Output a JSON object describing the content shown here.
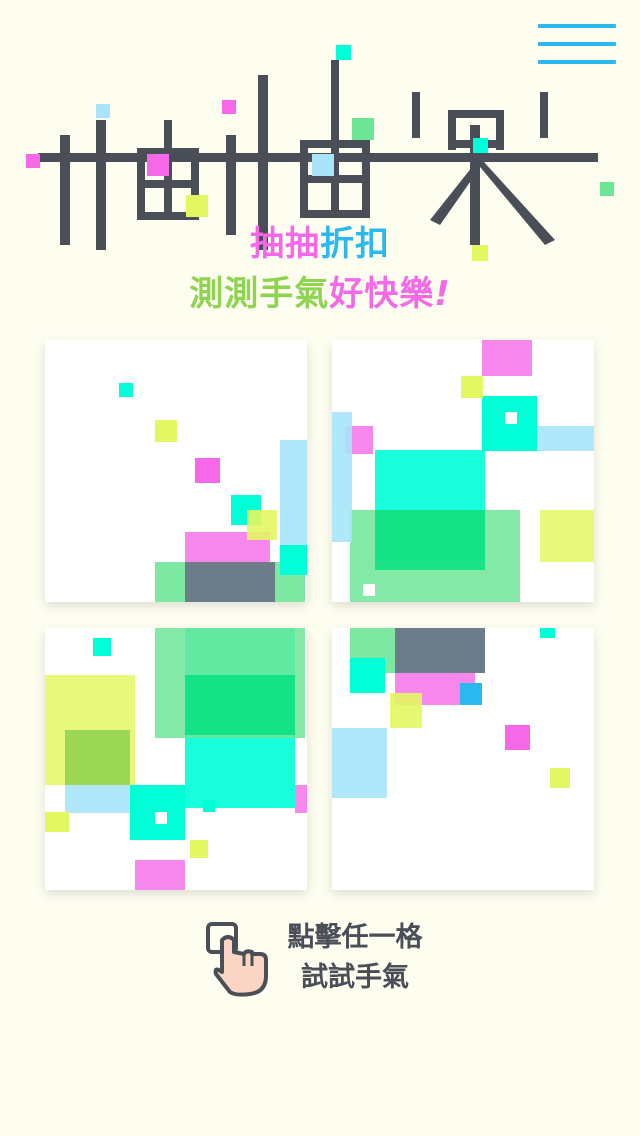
{
  "app": {
    "logo_title": "抽抽樂",
    "subtitle_line1": [
      "抽抽",
      "折扣"
    ],
    "subtitle_line2": [
      "測測手氣",
      "好快樂",
      "!"
    ]
  },
  "menu": {
    "icon": "hamburger-menu-icon"
  },
  "grid": {
    "tile_count": 4,
    "tiles": [
      "tile-1",
      "tile-2",
      "tile-3",
      "tile-4"
    ]
  },
  "hint": {
    "icon": "tap-hand-icon",
    "line1": "點擊任一格",
    "line2": "試試手氣"
  },
  "colors": {
    "background": "#fdfdf0",
    "text_dark": "#4a4e57",
    "pink": "#f569e9",
    "blue": "#29b9ee",
    "green": "#8fd451",
    "cyan": "#00ffd7",
    "yellow": "#e3f763"
  }
}
